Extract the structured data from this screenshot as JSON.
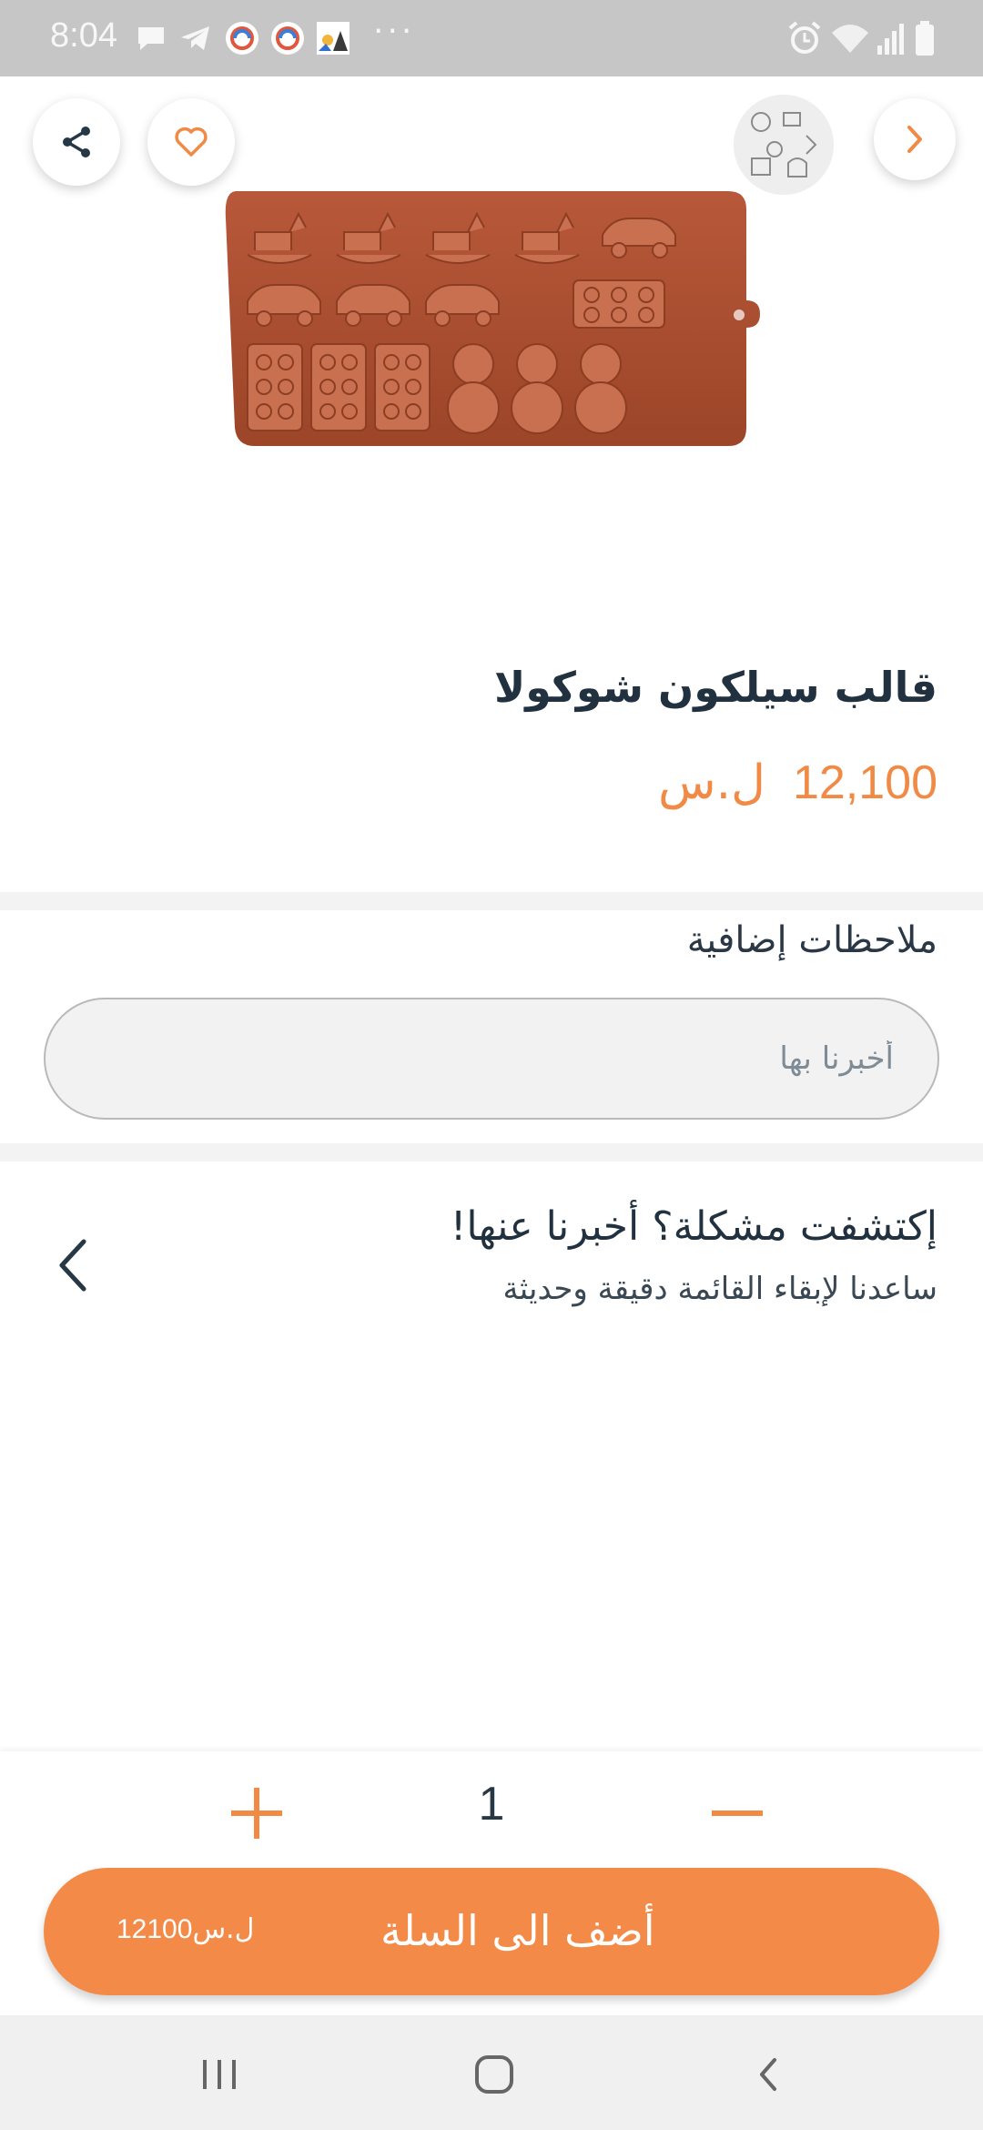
{
  "status_bar": {
    "time": "8:04",
    "left_icons": [
      "message-icon",
      "telegram-icon",
      "app-icon",
      "app-icon",
      "photo-icon"
    ],
    "overflow": "···",
    "right_icons": [
      "alarm-icon",
      "wifi-icon",
      "signal-icon",
      "battery-icon"
    ]
  },
  "header": {
    "share_icon": "share-icon",
    "favorite_icon": "heart-icon",
    "store_logo": "store-logo",
    "forward_icon": "chevron-right-icon"
  },
  "product": {
    "image": "chocolate-mold-image",
    "title": "قالب سيلكون شوكولا",
    "price": "12,100",
    "currency": "ل.س"
  },
  "notes": {
    "label": "ملاحظات إضافية",
    "placeholder": "أخبرنا بها",
    "value": ""
  },
  "report": {
    "title": "إكتشفت مشكلة؟ أخبرنا عنها!",
    "subtitle": "ساعدنا لإبقاء القائمة دقيقة وحديثة"
  },
  "cart": {
    "quantity": "1",
    "add_label": "أضف الى السلة",
    "total": "12100",
    "total_currency": "ل.س"
  },
  "colors": {
    "accent": "#f48a47",
    "text_dark": "#22313f",
    "status_bar": "#c6c6c6"
  }
}
